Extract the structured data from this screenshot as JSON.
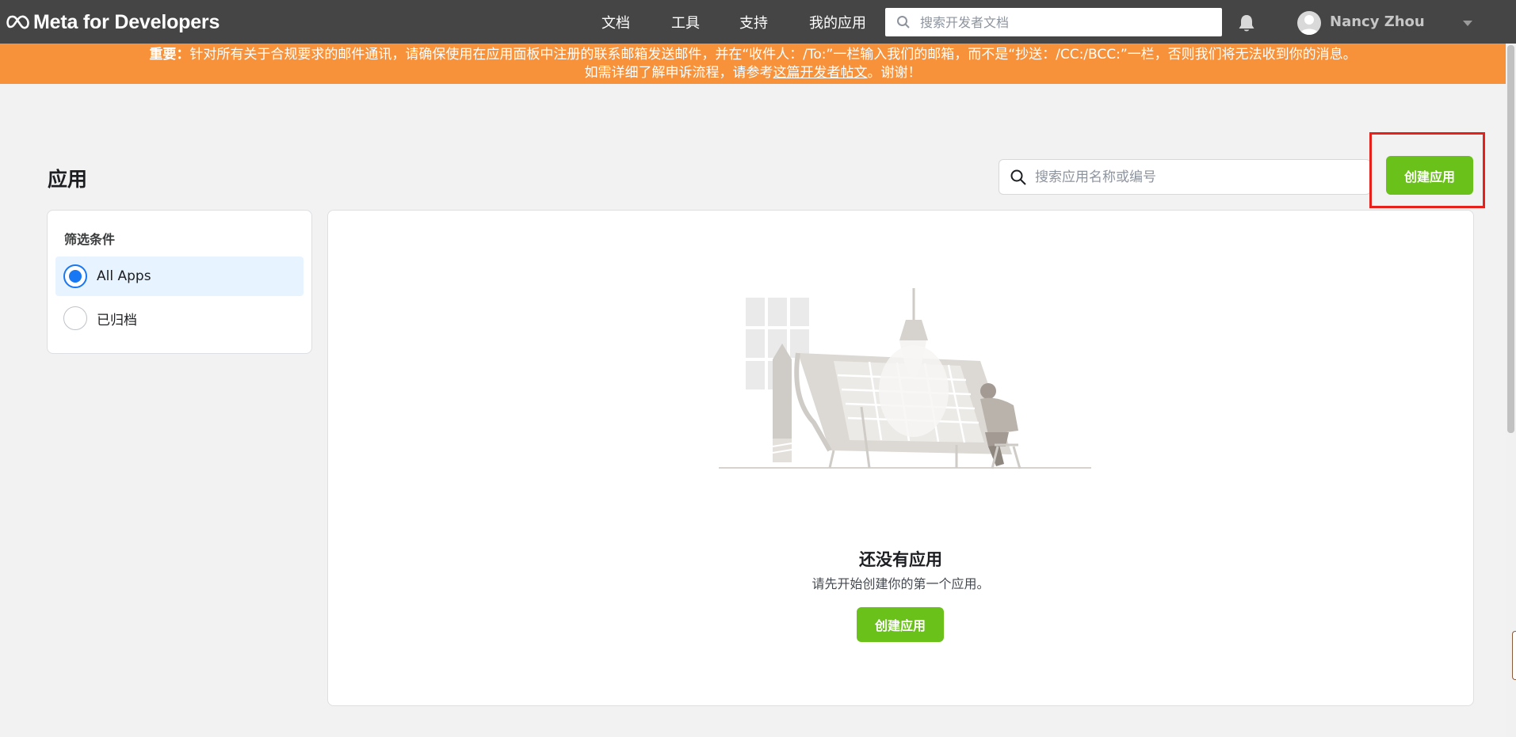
{
  "brand": {
    "logo_text": "Meta for Developers"
  },
  "nav": {
    "links": [
      "文档",
      "工具",
      "支持",
      "我的应用"
    ],
    "search_placeholder": "搜索开发者文档",
    "user_name": "Nancy Zhou"
  },
  "banner": {
    "bold_prefix": "重要：",
    "line1": "针对所有关于合规要求的邮件通讯，请确保使用在应用面板中注册的联系邮箱发送邮件，并在“收件人：/To:”一栏输入我们的邮箱，而不是“抄送：/CC:/BCC:”一栏，否则我们将无法收到你的消息。",
    "line2_before": "如需详细了解申诉流程，请参考",
    "line2_link": "这篇开发者帖文",
    "line2_after": "。谢谢！"
  },
  "page": {
    "title": "应用",
    "search_placeholder": "搜索应用名称或编号",
    "create_button": "创建应用"
  },
  "filter": {
    "title": "筛选条件",
    "options": [
      {
        "label": "All Apps",
        "selected": true
      },
      {
        "label": "已归档",
        "selected": false
      }
    ]
  },
  "empty_state": {
    "title": "还没有应用",
    "subtitle": "请先开始创建你的第一个应用。",
    "button": "创建应用"
  },
  "colors": {
    "nav_bg": "#454545",
    "banner_bg": "#f8923a",
    "primary_green": "#69c11a",
    "radio_blue": "#1877f2",
    "highlight_red": "#e8201c"
  }
}
